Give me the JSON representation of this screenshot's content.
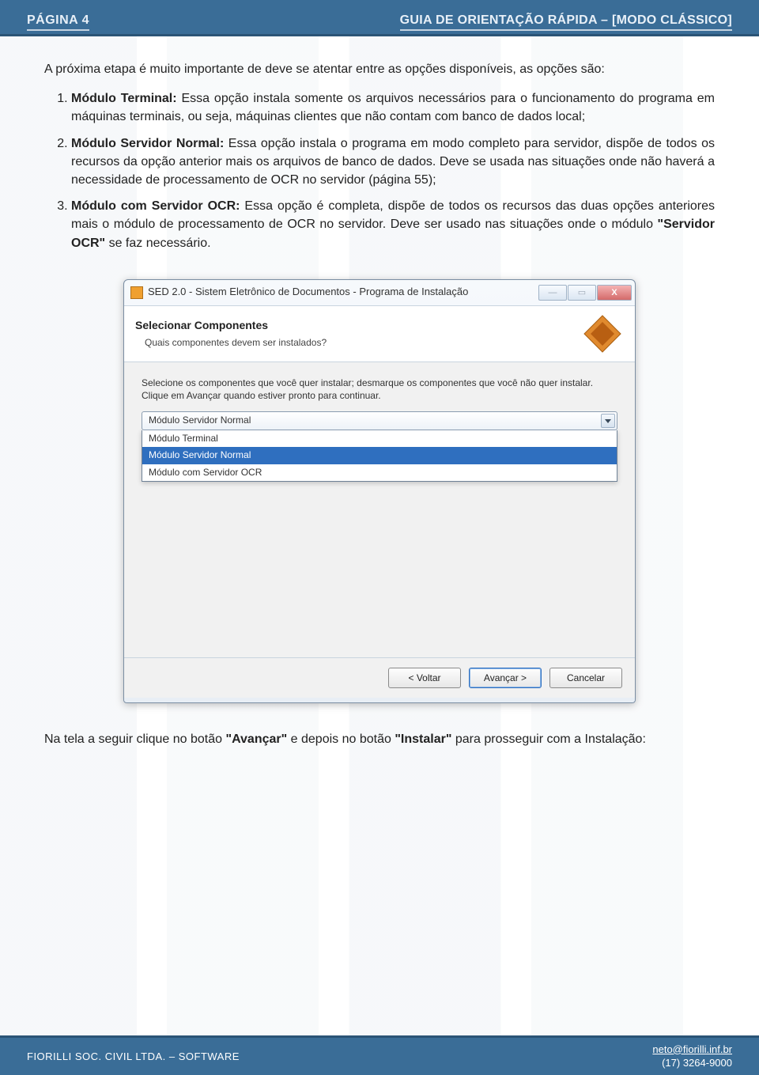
{
  "header": {
    "left": "PÁGINA 4",
    "right": "GUIA DE ORIENTAÇÃO RÁPIDA – [MODO CLÁSSICO]"
  },
  "intro": "A próxima etapa é muito importante de deve se atentar entre as opções disponíveis, as opções são:",
  "modules": [
    {
      "title": "Módulo Terminal:",
      "text": " Essa opção instala somente os arquivos necessários para o funcionamento do programa em máquinas terminais, ou seja, máquinas clientes que não contam com banco de dados local;"
    },
    {
      "title": "Módulo Servidor Normal:",
      "text": " Essa opção instala o programa em modo completo para servidor, dispõe de todos os recursos da opção anterior mais os arquivos de banco de dados. Deve se usada nas situações onde não haverá a necessidade de processamento de OCR no servidor (página 55);"
    },
    {
      "title": "Módulo com Servidor OCR:",
      "text_a": " Essa opção é completa, dispõe de todos os recursos das duas opções anteriores mais o módulo de processamento de OCR no servidor. Deve ser usado nas situações onde o módulo ",
      "strong": "\"Servidor OCR\"",
      "text_b": " se faz necessário."
    }
  ],
  "installer": {
    "window_title": "SED 2.0 - Sistem Eletrônico de Documentos - Programa de Instalação",
    "header_title": "Selecionar Componentes",
    "header_sub": "Quais componentes devem ser instalados?",
    "body_text": "Selecione os componentes que você quer instalar; desmarque os componentes que você não quer instalar. Clique em Avançar quando estiver pronto para continuar.",
    "combo_selected": "Módulo Servidor Normal",
    "options": [
      "Módulo Terminal",
      "Módulo Servidor Normal",
      "Módulo com Servidor OCR"
    ],
    "selected_index": 1,
    "btn_back": "< Voltar",
    "btn_next": "Avançar >",
    "btn_cancel": "Cancelar",
    "win_min": "—",
    "win_max": "▭",
    "win_close": "X"
  },
  "after_fig_a": "Na tela a seguir clique no botão ",
  "after_fig_b": "\"Avançar\"",
  "after_fig_c": " e depois no botão ",
  "after_fig_d": "\"Instalar\"",
  "after_fig_e": " para prosseguir com a Instalação:",
  "footer": {
    "left": "FIORILLI SOC. CIVIL LTDA. – SOFTWARE",
    "email": "neto@fiorilli.inf.br",
    "phone": "(17) 3264-9000"
  }
}
